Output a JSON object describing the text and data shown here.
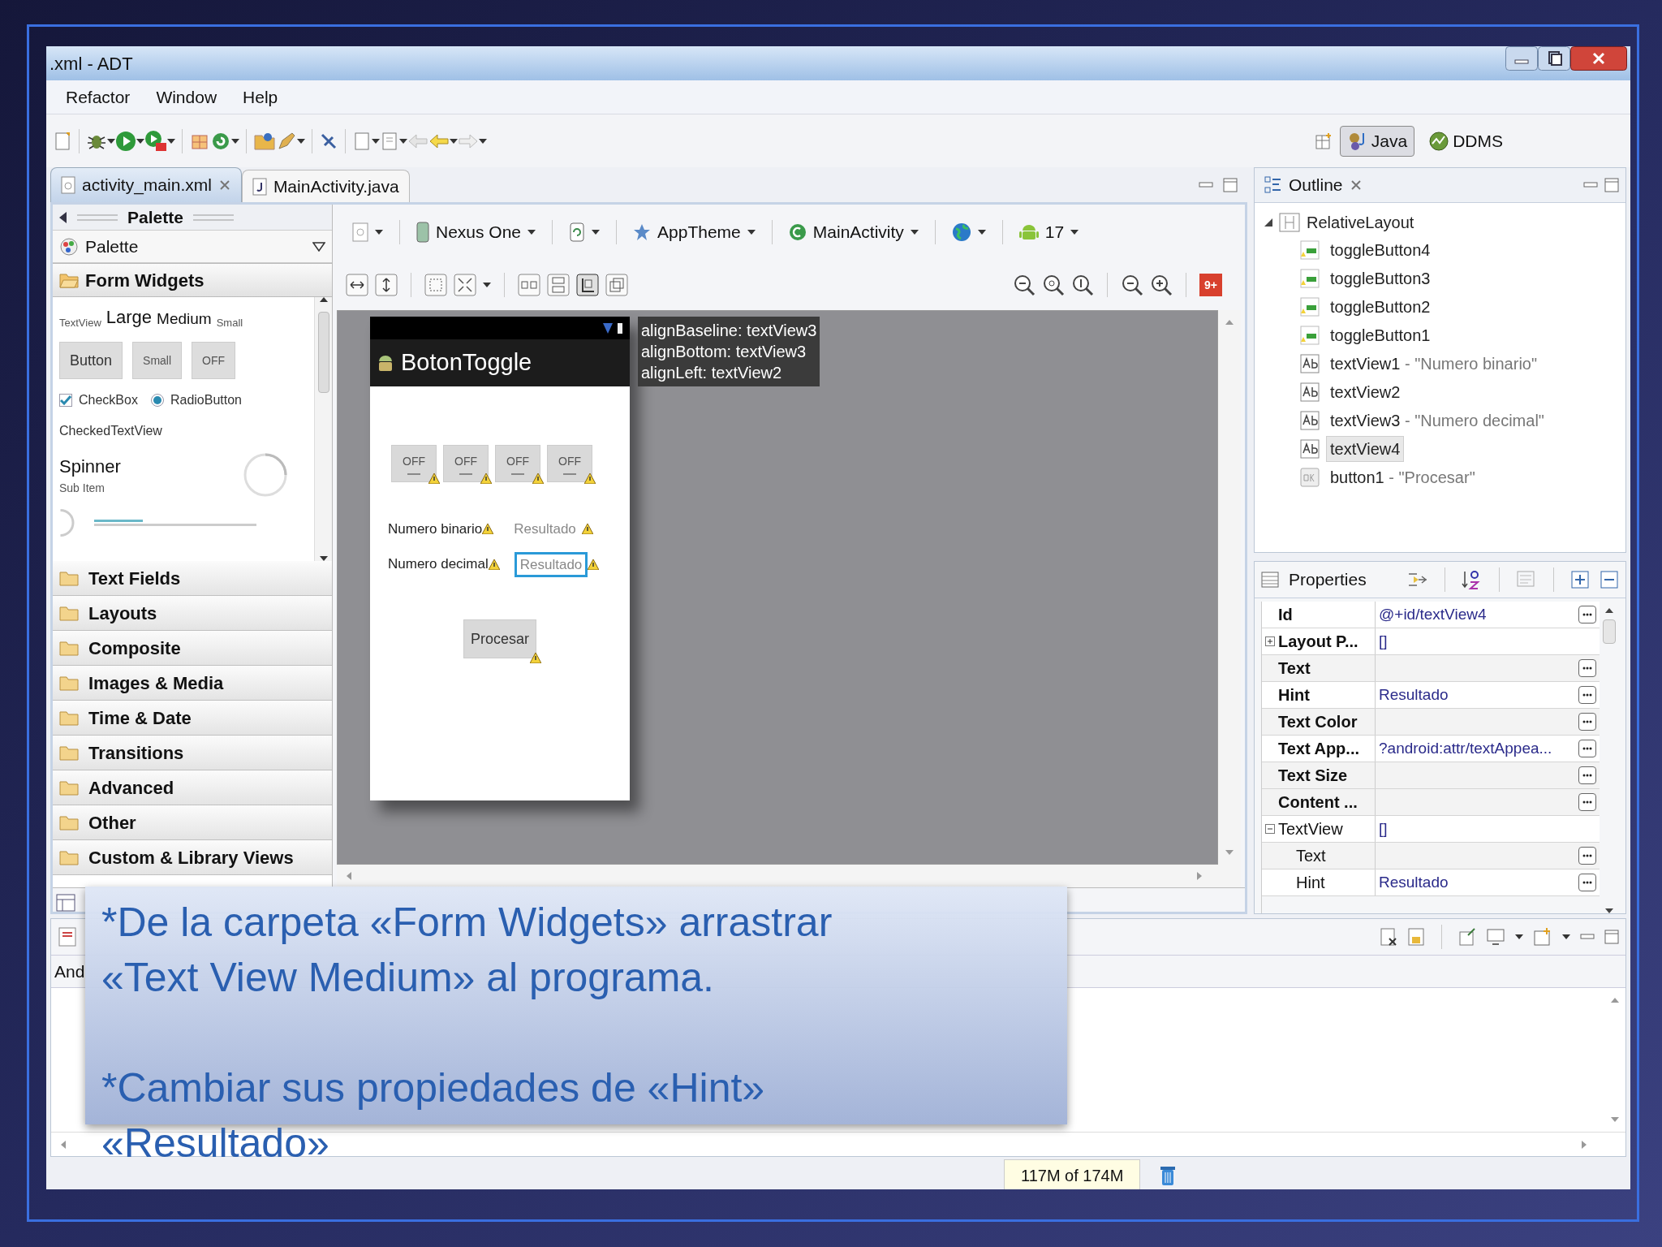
{
  "window": {
    "title": ".xml - ADT"
  },
  "menu": [
    "Refactor",
    "Window",
    "Help"
  ],
  "perspectives": [
    {
      "label": "Java",
      "selected": true
    },
    {
      "label": "DDMS",
      "selected": false
    }
  ],
  "editor_tabs": [
    {
      "label": "activity_main.xml",
      "selected": true
    },
    {
      "label": "MainActivity.java",
      "selected": false
    }
  ],
  "palette": {
    "header": "Palette",
    "dropdown": "Palette",
    "open_category": "Form Widgets",
    "text_sizes": [
      "TextView",
      "Large",
      "Medium",
      "Small"
    ],
    "buttons": [
      "Button",
      "Small",
      "OFF"
    ],
    "checkbox": {
      "label": "CheckBox",
      "checked": true
    },
    "radio": {
      "label": "RadioButton",
      "selected": true
    },
    "checked_text": "CheckedTextView",
    "spinner": {
      "label": "Spinner",
      "sub": "Sub Item"
    },
    "categories": [
      "Text Fields",
      "Layouts",
      "Composite",
      "Images & Media",
      "Time & Date",
      "Transitions",
      "Advanced",
      "Other",
      "Custom & Library Views"
    ]
  },
  "canvas_toolbar": {
    "device": "Nexus One",
    "theme": "AppTheme",
    "activity": "MainActivity",
    "api": "17",
    "badge": "9+"
  },
  "device": {
    "title": "BotonToggle",
    "toggles": [
      "OFF",
      "OFF",
      "OFF",
      "OFF"
    ],
    "rows": [
      {
        "label": "Numero binario",
        "hint": "Resultado",
        "selected": false
      },
      {
        "label": "Numero decimal",
        "hint": "Resultado",
        "selected": true
      }
    ],
    "button": "Procesar"
  },
  "tooltip": [
    "alignBaseline: textView3",
    "alignBottom: textView3",
    "alignLeft: textView2"
  ],
  "outline": {
    "title": "Outline",
    "root": {
      "name": "RelativeLayout",
      "expanded": true,
      "children": [
        {
          "kind": "toggle",
          "name": "toggleButton4",
          "selected": false
        },
        {
          "kind": "toggle",
          "name": "toggleButton3",
          "selected": false
        },
        {
          "kind": "toggle",
          "name": "toggleButton2",
          "selected": false
        },
        {
          "kind": "toggle",
          "name": "toggleButton1",
          "selected": false
        },
        {
          "kind": "text",
          "name": "textView1",
          "detail": "- \"Numero binario\"",
          "selected": false
        },
        {
          "kind": "text",
          "name": "textView2",
          "selected": false
        },
        {
          "kind": "text",
          "name": "textView3",
          "detail": "- \"Numero decimal\"",
          "selected": false
        },
        {
          "kind": "text",
          "name": "textView4",
          "selected": true
        },
        {
          "kind": "button",
          "name": "button1",
          "detail": "- \"Procesar\"",
          "selected": false
        }
      ]
    }
  },
  "properties": {
    "title": "Properties",
    "rows": [
      {
        "kind": "property",
        "name": "Id",
        "value": "@+id/textView4"
      },
      {
        "kind": "group",
        "name": "Layout P...",
        "value": "[]",
        "expanded": false,
        "bold": true
      },
      {
        "kind": "property",
        "name": "Text"
      },
      {
        "kind": "property",
        "name": "Hint",
        "value": "Resultado"
      },
      {
        "kind": "property",
        "name": "Text Color"
      },
      {
        "kind": "property",
        "name": "Text App...",
        "value": "?android:attr/textAppea..."
      },
      {
        "kind": "property",
        "name": "Text Size"
      },
      {
        "kind": "property",
        "name": "Content ..."
      },
      {
        "kind": "group",
        "name": "TextView",
        "value": "[]",
        "expanded": true,
        "bold": false,
        "children": [
          {
            "kind": "property",
            "name": "Text"
          },
          {
            "kind": "property",
            "name": "Hint",
            "value": "Resultado"
          }
        ]
      }
    ]
  },
  "console": {
    "label": "And"
  },
  "status": {
    "memory": "117M of 174M"
  },
  "callout": {
    "paragraphs": [
      [
        "*De la carpeta «Form Widgets» arrastrar",
        "«Text View Medium» al programa."
      ],
      [
        "*Cambiar sus propiedades de «Hint»",
        "«Resultado»"
      ]
    ]
  }
}
